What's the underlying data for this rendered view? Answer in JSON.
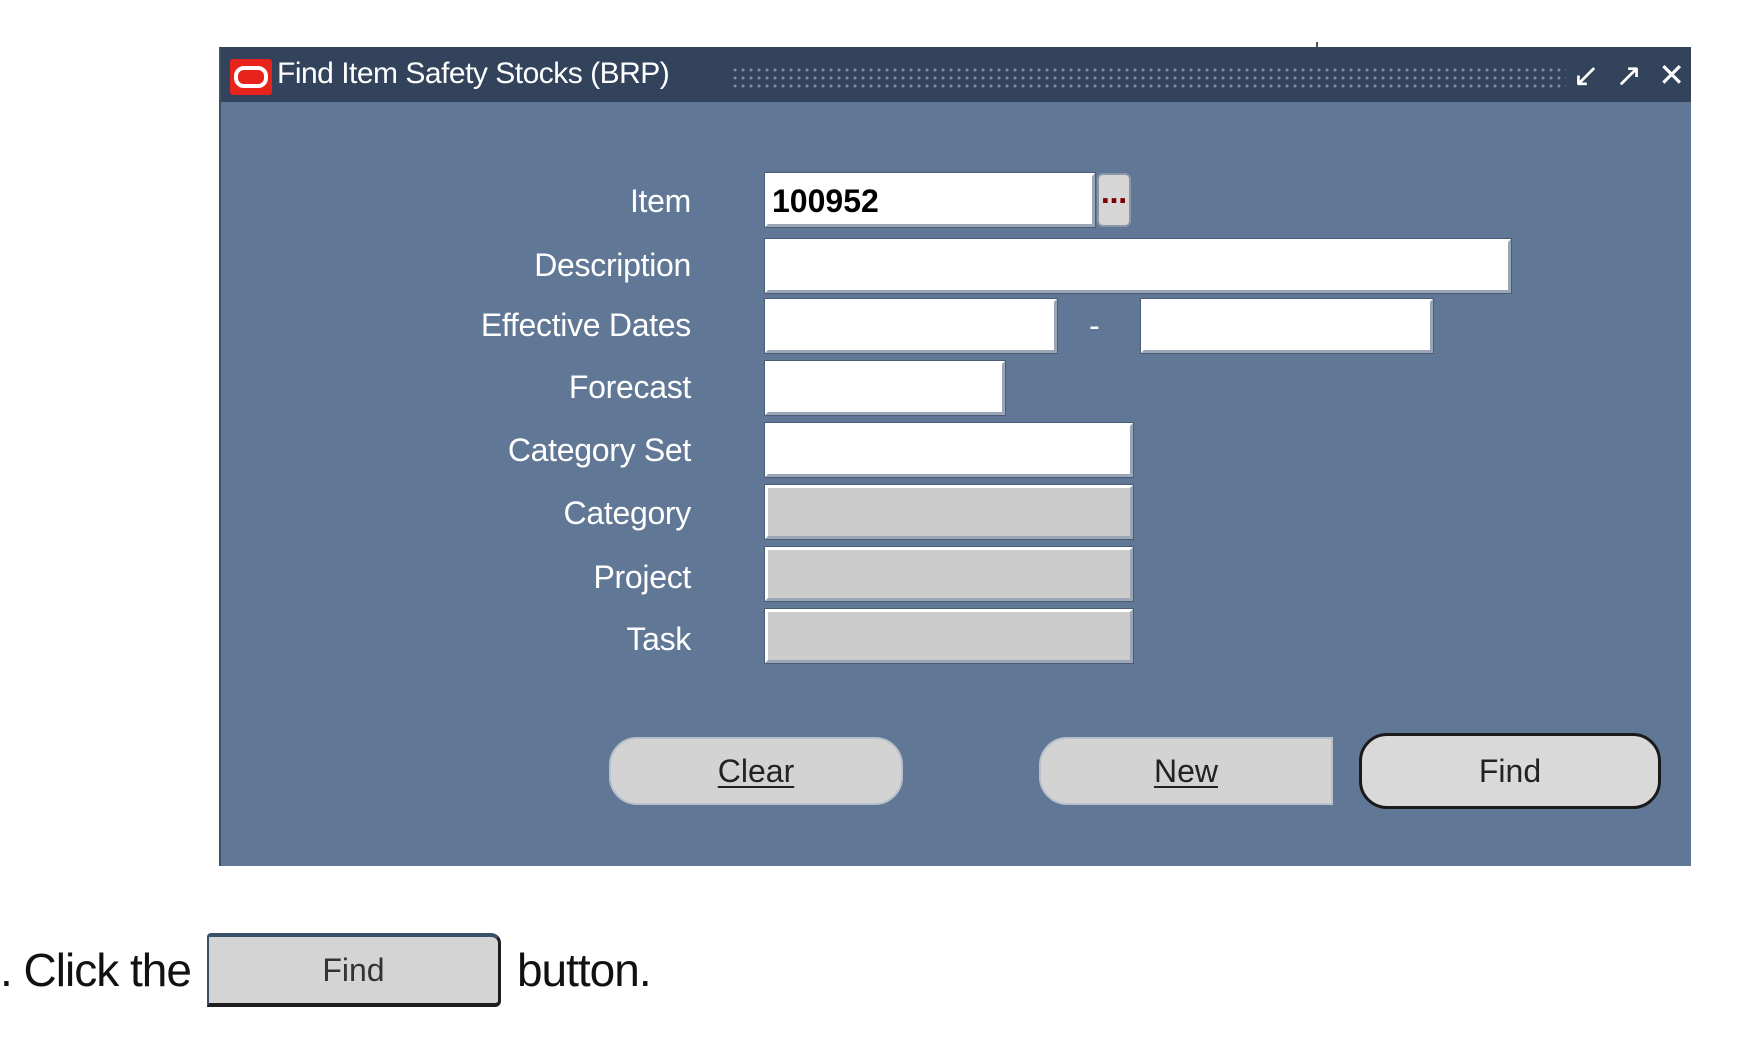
{
  "window": {
    "title": "Find Item Safety Stocks (BRP)",
    "controls": {
      "minimize": "↙",
      "maximize": "↗",
      "close": "✕"
    }
  },
  "form": {
    "item": {
      "label": "Item",
      "value": "100952",
      "lov": "…"
    },
    "description": {
      "label": "Description",
      "value": ""
    },
    "effective_dates": {
      "label": "Effective Dates",
      "from": "",
      "separator": "-",
      "to": ""
    },
    "forecast": {
      "label": "Forecast",
      "value": ""
    },
    "category_set": {
      "label": "Category Set",
      "value": ""
    },
    "category": {
      "label": "Category",
      "value": ""
    },
    "project": {
      "label": "Project",
      "value": ""
    },
    "task": {
      "label": "Task",
      "value": ""
    }
  },
  "buttons": {
    "clear": "Clear",
    "new": "New",
    "find": "Find"
  },
  "instruction": {
    "prefix": ".  Click the",
    "button": "Find",
    "suffix": "button."
  },
  "colors": {
    "window_bg": "#617796",
    "titlebar_bg": "#32435b",
    "logo": "#e8231c",
    "disabled_field": "#cccccc"
  }
}
